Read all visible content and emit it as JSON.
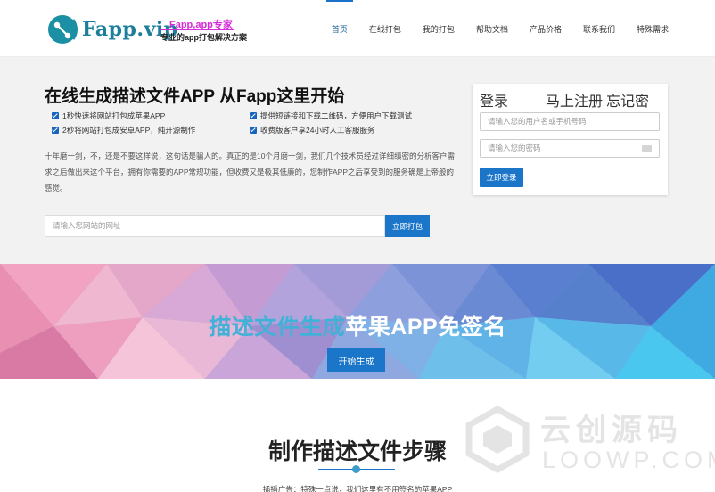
{
  "header": {
    "brand": "Fapp.vip",
    "tagline_top": "Fapp,app专家",
    "tagline_bottom": "专业的app打包解决方案",
    "nav": [
      "首页",
      "在线打包",
      "我的打包",
      "帮助文档",
      "产品价格",
      "联系我们",
      "特殊需求"
    ],
    "active_nav": "首页"
  },
  "hero": {
    "title": "在线生成描述文件APP 从Fapp这里开始",
    "features": [
      "1秒快速将网站打包成苹果APP",
      "提供短链接和下载二维码，方便用户下载测试",
      "2秒将网站打包成安卓APP，纯开源制作",
      "收费版客户享24小时人工客服服务"
    ],
    "description": "十年磨一剑，不，还是不要这样说，这句话是骗人的。真正的是10个月磨一剑，我们几个技术员经过详细缜密的分析客户需求之后做出来这个平台，拥有你需要的APP常规功能，但收费又是极其低廉的，您制作APP之后享受到的服务确是上帝般的感觉。",
    "url_placeholder": "请输入您网站的网址",
    "pack_button": "立即打包"
  },
  "login": {
    "tab_login": "登录",
    "tab_register": "马上注册",
    "tab_forgot": "忘记密码?",
    "username_placeholder": "请输入您的用户名或手机号码",
    "password_placeholder": "请输入您的密码",
    "login_button": "立即登录"
  },
  "banner": {
    "title_part1": "描述文件生成",
    "title_part2": "苹果APP免签名",
    "button": "开始生成"
  },
  "steps": {
    "title": "制作描述文件步骤",
    "subtitle": "插播广告：特殊一点说，我们这里有不用签名的苹果APP"
  },
  "watermark": {
    "text": "云创源码",
    "sub": "LOOWP.COM"
  },
  "colors": {
    "accent": "#1b75c9",
    "brand": "#1b7f9b",
    "tagline": "#d52bd8",
    "banner_highlight": "#42b1d8"
  }
}
